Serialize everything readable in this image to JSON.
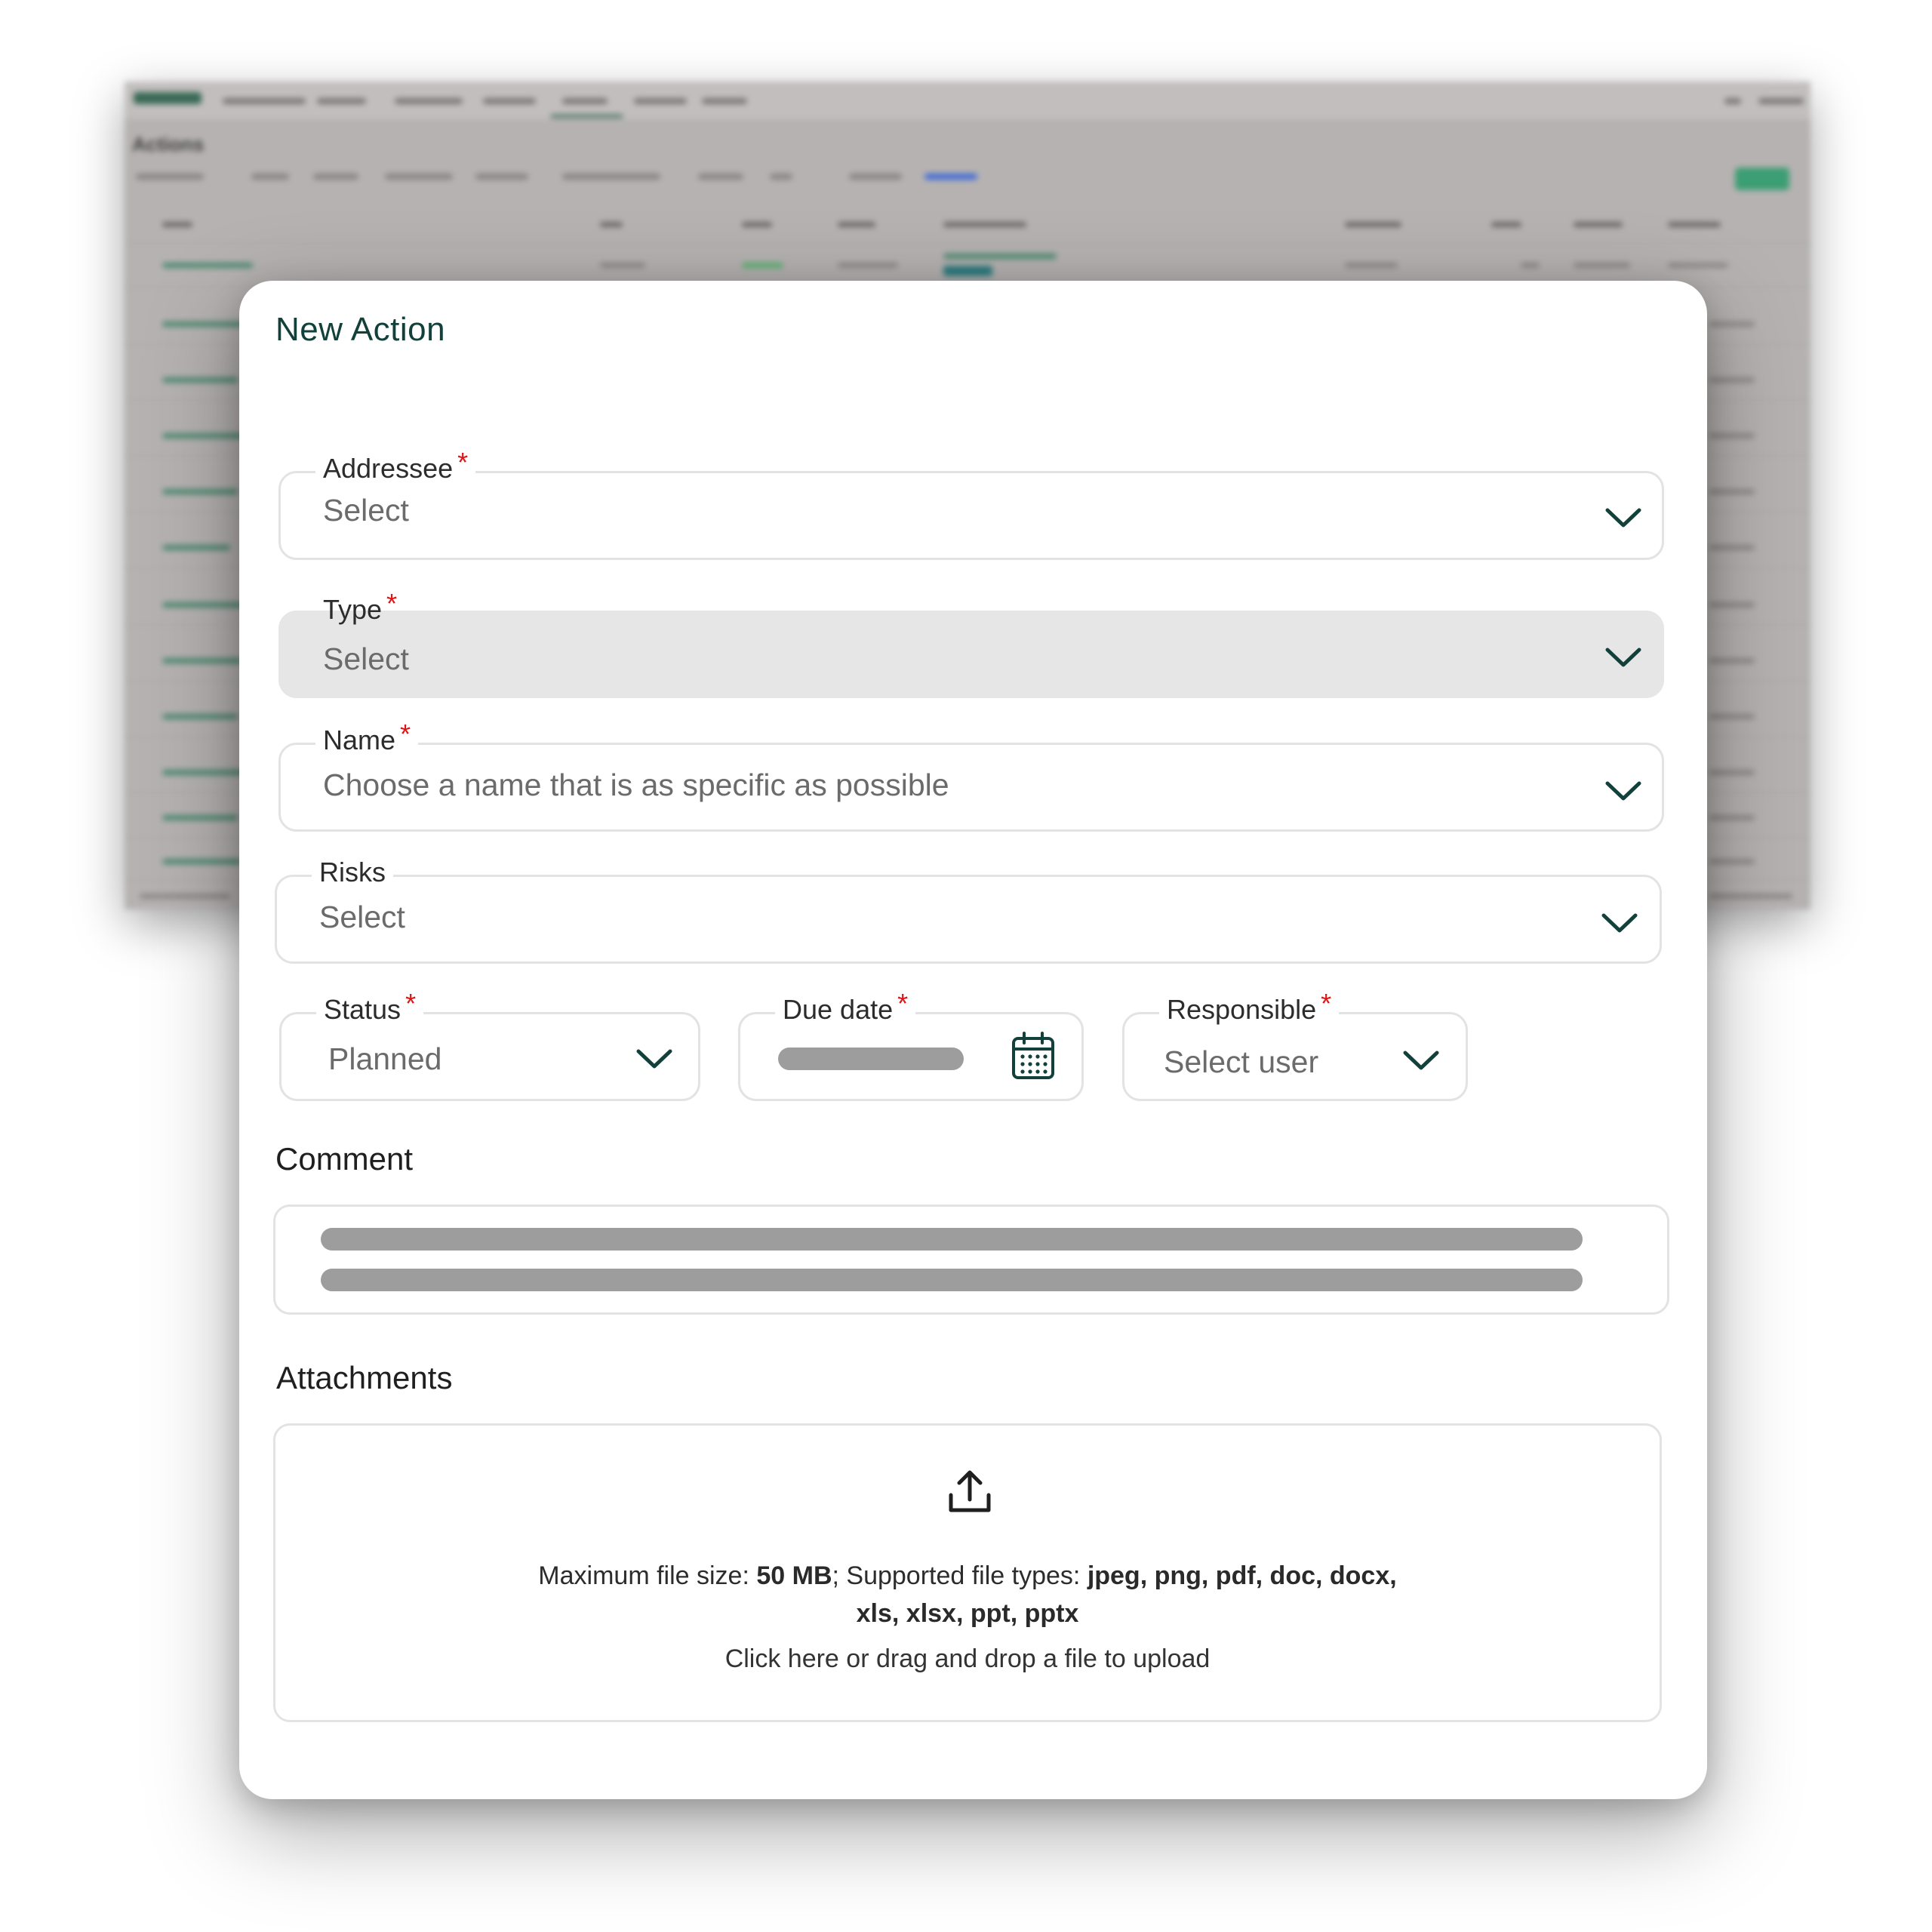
{
  "modal": {
    "title": "New Action",
    "fields": {
      "addressee": {
        "label": "Addressee",
        "required": "*",
        "value": "Select"
      },
      "type": {
        "label": "Type",
        "required": "*",
        "value": "Select"
      },
      "name": {
        "label": "Name",
        "required": "*",
        "placeholder": "Choose a name that is as specific as possible"
      },
      "risks": {
        "label": "Risks",
        "value": "Select"
      },
      "status": {
        "label": "Status",
        "required": "*",
        "value": "Planned"
      },
      "due_date": {
        "label": "Due date",
        "required": "*"
      },
      "responsible": {
        "label": "Responsible",
        "required": "*",
        "value": "Select user"
      }
    },
    "comment": {
      "label": "Comment"
    },
    "attachments": {
      "label": "Attachments",
      "max_size_prefix": "Maximum file size: ",
      "max_size": "50 MB",
      "types_prefix": "; Supported file types: ",
      "types_line1": "jpeg, png, pdf, doc, docx,",
      "types_line2": "xls, xlsx, ppt, pptx",
      "cta": "Click here or drag and drop a file to upload"
    }
  },
  "background": {
    "page_title": "Actions"
  },
  "icons": {
    "dropdown": "chevron-down-icon",
    "calendar": "calendar-icon",
    "upload": "upload-icon"
  },
  "colors": {
    "title": "#12403a",
    "required": "#e01414",
    "chevron": "#12403a",
    "accent": "#3c9e73"
  }
}
